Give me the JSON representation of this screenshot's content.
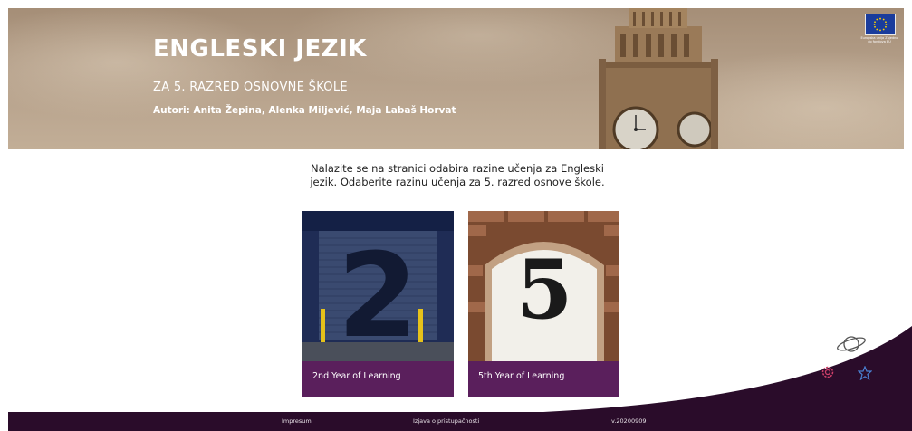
{
  "hero": {
    "title": "ENGLESKI JEZIK",
    "subtitle": "ZA 5. RAZRED OSNOVNE ŠKOLE",
    "authors": "Autori: Anita Žepina, Alenka Miljević, Maja Labaš Horvat",
    "eu_caption": "Europska unija Zajedno do fondova EU"
  },
  "intro": {
    "line1": "Nalazite se na stranici odabira razine učenja za Engleski",
    "line2": "jezik. Odaberite razinu učenja za 5. razred osnove škole."
  },
  "cards": [
    {
      "label": "2nd Year of Learning",
      "numeral": "2"
    },
    {
      "label": "5th Year of Learning",
      "numeral": "5"
    }
  ],
  "footer": {
    "impressum": "Impresum",
    "accessibility": "Izjava o pristupačnosti",
    "version": "v.20200909"
  },
  "colors": {
    "accent_purple": "#5a1f5c",
    "footer_bg": "#2a0c2a",
    "gear": "#d0406a",
    "star": "#4a7fd0"
  },
  "icons": [
    "planet-icon",
    "gear-icon",
    "star-icon",
    "eu-flag-icon"
  ]
}
